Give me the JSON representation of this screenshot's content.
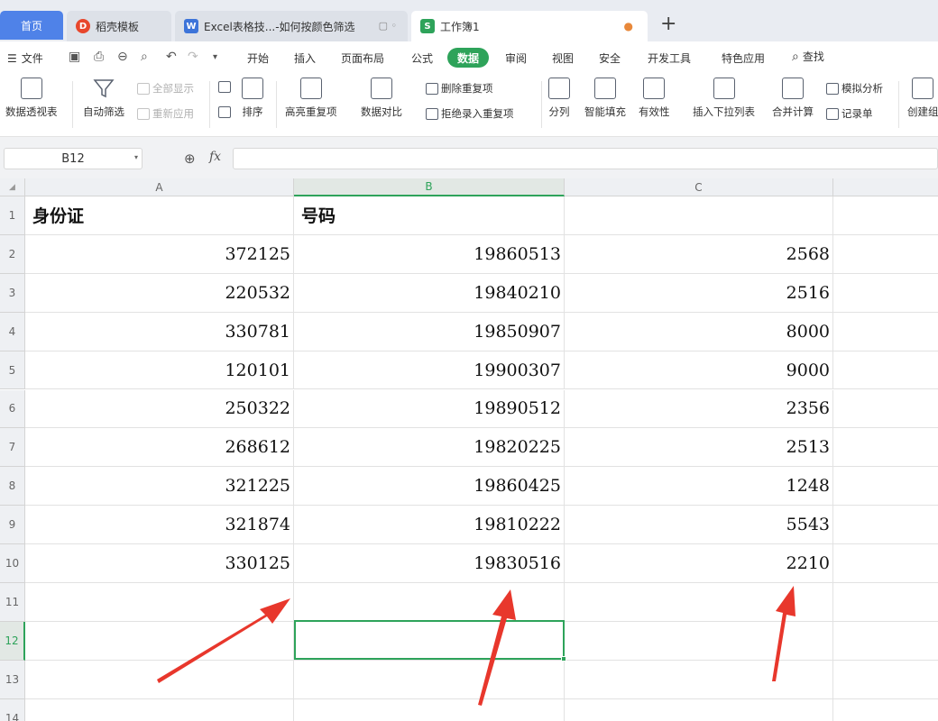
{
  "tabs": {
    "home": "首页",
    "t1": "稻壳模板",
    "t2": "Excel表格技...-如何按颜色筛选",
    "t3": "工作簿1",
    "new": "+"
  },
  "menu": {
    "file": "文件",
    "items": [
      "开始",
      "插入",
      "页面布局",
      "公式",
      "数据",
      "审阅",
      "视图",
      "安全",
      "开发工具",
      "特色应用"
    ],
    "search": "查找"
  },
  "ribbon": {
    "pivot": "数据透视表",
    "autofilter": "自动筛选",
    "showall": "全部显示",
    "reapply": "重新应用",
    "sort": "排序",
    "highlight_dup": "高亮重复项",
    "compare": "数据对比",
    "del_dup": "删除重复项",
    "reject_dup": "拒绝录入重复项",
    "split": "分列",
    "flash_fill": "智能填充",
    "validity": "有效性",
    "dropdown": "插入下拉列表",
    "consolidate": "合并计算",
    "whatif": "模拟分析",
    "record": "记录单",
    "create": "创建组"
  },
  "formula_bar": {
    "name_box": "B12",
    "fx": "fx",
    "content": ""
  },
  "grid": {
    "columns": [
      "A",
      "B",
      "C"
    ],
    "selected_column": "B",
    "selected_row": 12,
    "rows": [
      {
        "n": "1",
        "a": "身份证",
        "b": "号码",
        "c": ""
      },
      {
        "n": "2",
        "a": "372125",
        "b": "19860513",
        "c": "2568"
      },
      {
        "n": "3",
        "a": "220532",
        "b": "19840210",
        "c": "2516"
      },
      {
        "n": "4",
        "a": "330781",
        "b": "19850907",
        "c": "8000"
      },
      {
        "n": "5",
        "a": "120101",
        "b": "19900307",
        "c": "9000"
      },
      {
        "n": "6",
        "a": "250322",
        "b": "19890512",
        "c": "2356"
      },
      {
        "n": "7",
        "a": "268612",
        "b": "19820225",
        "c": "2513"
      },
      {
        "n": "8",
        "a": "321225",
        "b": "19860425",
        "c": "1248"
      },
      {
        "n": "9",
        "a": "321874",
        "b": "19810222",
        "c": "5543"
      },
      {
        "n": "10",
        "a": "330125",
        "b": "19830516",
        "c": "2210"
      },
      {
        "n": "11",
        "a": "",
        "b": "",
        "c": ""
      },
      {
        "n": "12",
        "a": "",
        "b": "",
        "c": ""
      },
      {
        "n": "13",
        "a": "",
        "b": "",
        "c": ""
      },
      {
        "n": "14",
        "a": "",
        "b": "",
        "c": ""
      }
    ]
  },
  "colors": {
    "accent": "#2ea35a",
    "home_tab": "#4f82e8",
    "arrow": "#e8372c"
  }
}
